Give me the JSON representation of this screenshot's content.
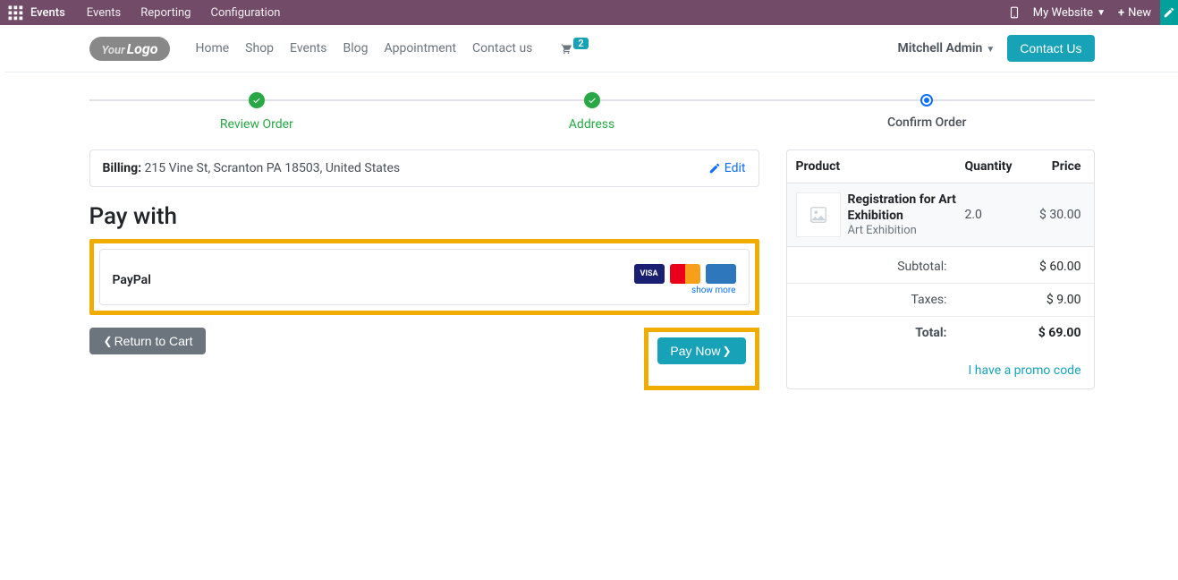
{
  "admin": {
    "brand": "Events",
    "menu": [
      "Events",
      "Reporting",
      "Configuration"
    ],
    "website_label": "My Website",
    "new_label": "New"
  },
  "nav": {
    "items": [
      "Home",
      "Shop",
      "Events",
      "Blog",
      "Appointment",
      "Contact us"
    ],
    "cart_count": "2",
    "user": "Mitchell Admin",
    "contact_btn": "Contact Us"
  },
  "wizard": {
    "steps": [
      "Review Order",
      "Address",
      "Confirm Order"
    ]
  },
  "billing": {
    "label": "Billing:",
    "address": "215 Vine St, Scranton PA 18503, United States",
    "edit": "Edit"
  },
  "payment": {
    "heading": "Pay with",
    "option_name": "PayPal",
    "cards": [
      "VISA",
      "MC",
      "AMEX"
    ],
    "show_more": "show more"
  },
  "actions": {
    "return": "Return to Cart",
    "pay_now": "Pay Now"
  },
  "summary": {
    "headers": {
      "product": "Product",
      "quantity": "Quantity",
      "price": "Price"
    },
    "item": {
      "name": "Registration for Art Exhibition",
      "sub": "Art Exhibition",
      "qty": "2.0",
      "price": "$ 30.00"
    },
    "subtotal_label": "Subtotal:",
    "subtotal": "$ 60.00",
    "taxes_label": "Taxes:",
    "taxes": "$ 9.00",
    "total_label": "Total:",
    "total": "$ 69.00",
    "promo": "I have a promo code"
  }
}
